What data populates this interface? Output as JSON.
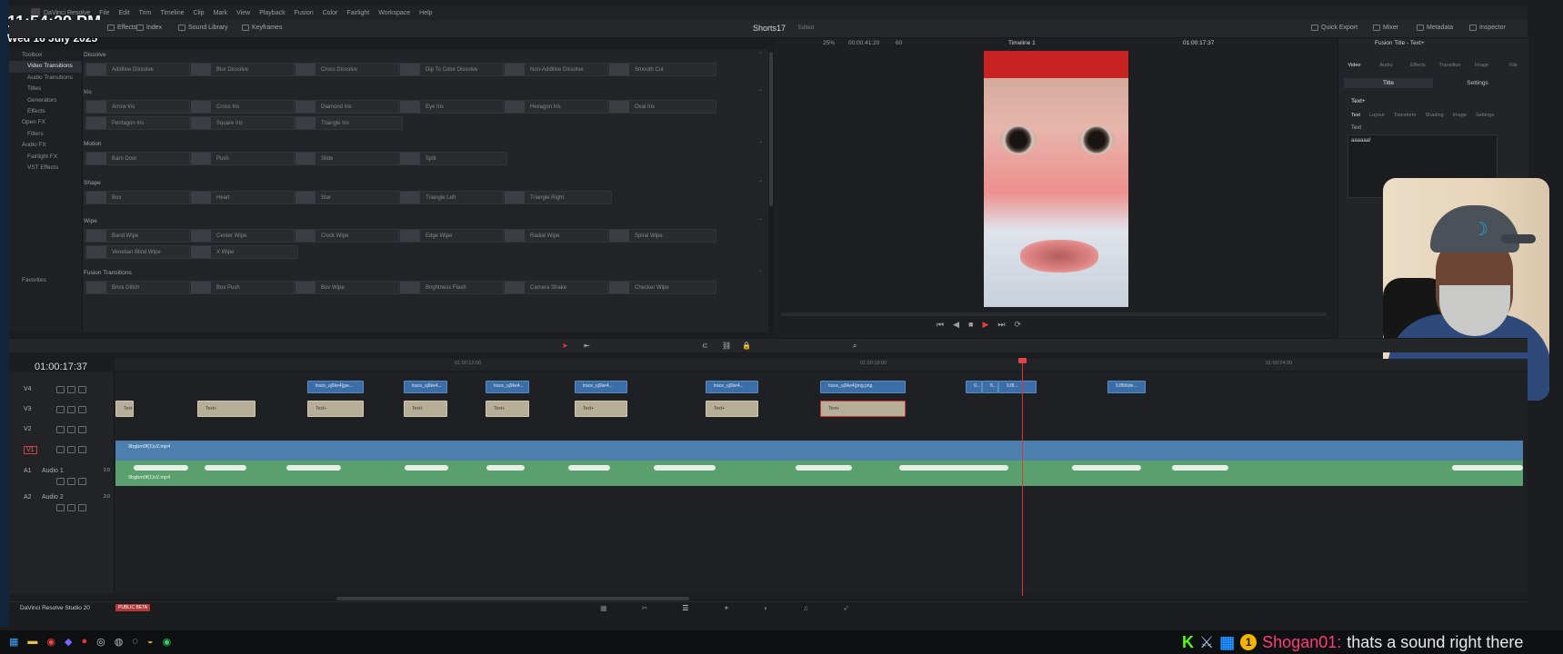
{
  "clock": {
    "time": "11:54:29 PM",
    "date": "Wed 16 July 2025"
  },
  "menu": [
    "DaVinci Resolve",
    "File",
    "Edit",
    "Trim",
    "Timeline",
    "Clip",
    "Mark",
    "View",
    "Playback",
    "Fusion",
    "Color",
    "Fairlight",
    "Workspace",
    "Help"
  ],
  "toolbar": {
    "left": [
      "Effects",
      "Index",
      "Sound Library",
      "Keyframes"
    ],
    "project_title": "Shorts17",
    "project_sub": "Edited",
    "right": [
      "Quick Export",
      "Mixer",
      "Metadata",
      "Inspector"
    ]
  },
  "viewer": {
    "zoom": "25%",
    "duration": "00:00:41:20",
    "fps": "60",
    "timeline_name": "Timeline 1",
    "timecode": "01:00:17:37"
  },
  "sidebar": [
    "Toolbox",
    "Video Transitions",
    "Audio Transitions",
    "Titles",
    "Generators",
    "Effects",
    "Open FX",
    "Filters",
    "Audio FX",
    "Fairlight FX",
    "VST Effects",
    "Favorites"
  ],
  "effects": {
    "sections": [
      {
        "name": "Dissolve",
        "items": [
          "Additive Dissolve",
          "Blur Dissolve",
          "Cross Dissolve",
          "Dip To Color Dissolve",
          "Non-Additive Dissolve",
          "Smooth Cut"
        ]
      },
      {
        "name": "Iris",
        "items": [
          "Arrow Iris",
          "Cross Iris",
          "Diamond Iris",
          "Eye Iris",
          "Hexagon Iris",
          "Oval Iris",
          "Pentagon Iris",
          "Square Iris",
          "Triangle Iris"
        ]
      },
      {
        "name": "Motion",
        "items": [
          "Barn Door",
          "Push",
          "Slide",
          "Split"
        ]
      },
      {
        "name": "Shape",
        "items": [
          "Box",
          "Heart",
          "Star",
          "Triangle Left",
          "Triangle Right"
        ]
      },
      {
        "name": "Wipe",
        "items": [
          "Band Wipe",
          "Center Wipe",
          "Clock Wipe",
          "Edge Wipe",
          "Radial Wipe",
          "Spiral Wipe",
          "Venetian Blind Wipe",
          "X Wipe"
        ]
      },
      {
        "name": "Fusion Transitions",
        "items": [
          "Brick Glitch",
          "Box Push",
          "Box Wipe",
          "Brightness Flash",
          "Camera Shake",
          "Checker Wipe"
        ]
      }
    ]
  },
  "inspector": {
    "header": "Fusion Title - Text+",
    "tabs": [
      "Video",
      "Audio",
      "Effects",
      "Transition",
      "Image",
      "File"
    ],
    "subtabs": [
      "Title",
      "Settings"
    ],
    "section": "Text+",
    "texttabs": [
      "Text",
      "Layout",
      "Transform",
      "Shading",
      "Image",
      "Settings"
    ],
    "text_label": "Text",
    "text_value": "aaaaaa!"
  },
  "timeline": {
    "timecode": "01:00:17:37",
    "ruler": [
      "01:00:12:00",
      "01:00:18:00",
      "01:00:24:00"
    ],
    "tracks": [
      {
        "name": "V4",
        "label": ""
      },
      {
        "name": "V3",
        "label": ""
      },
      {
        "name": "V2",
        "label": ""
      },
      {
        "name": "V1",
        "label": ""
      },
      {
        "name": "A1",
        "label": "Audio 1",
        "ch": "2.0"
      },
      {
        "name": "A2",
        "label": "Audio 2",
        "ch": "2.0"
      }
    ],
    "image_clips": [
      "trace_uj9ke4(jpe...",
      "trace_uj9ke4...",
      "trace_uj9ke4...",
      "trace_uj9ke4...",
      "trace_uj9ke4...",
      "trace_uj9ke4(png.png",
      "9...",
      "8...",
      "9.f8...",
      "9.f8b6de..."
    ],
    "title_clips": [
      "Text+",
      "Text+",
      "Text+",
      "Text+",
      "Text+",
      "Text+",
      "Text+",
      "Text+",
      "Text+"
    ],
    "video_clip": "9bgbm0f(1)v2.mp4",
    "audio_clip": "9bgbm0f(1)v2.mp4"
  },
  "bottom": {
    "brand": "DaVinci Resolve Studio 20",
    "badge": "PUBLIC BETA"
  },
  "chat": {
    "user": "Shogan01:",
    "message": "thats a sound right there",
    "k": "K",
    "badge": "1"
  }
}
